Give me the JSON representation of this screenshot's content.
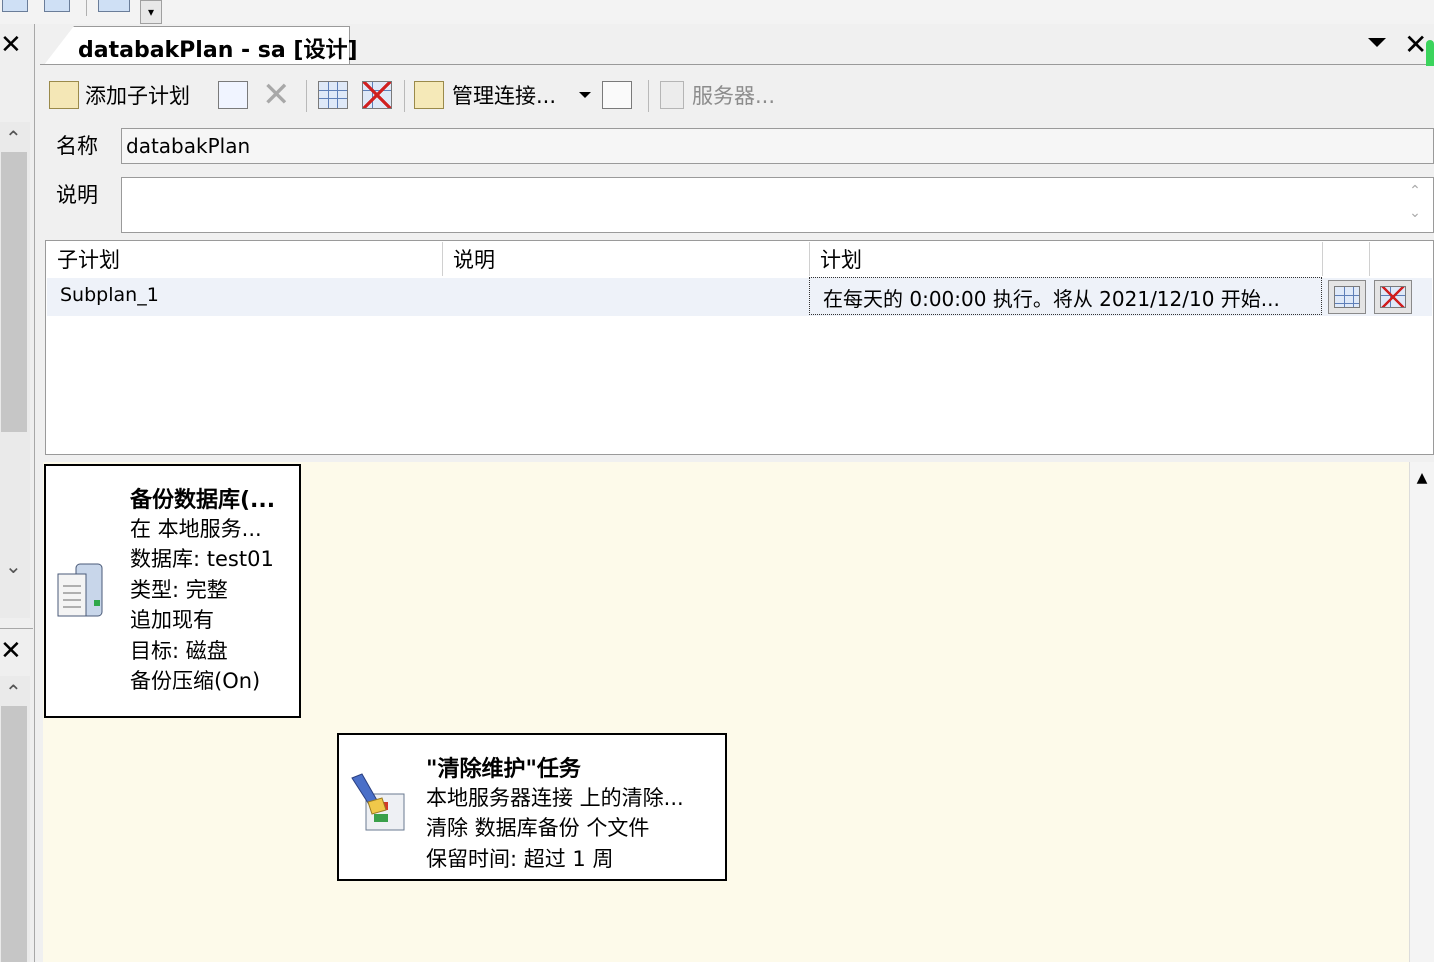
{
  "document_tab": {
    "title": "databakPlan - sa [设计]"
  },
  "toolbar": {
    "add_subplan": "添加子计划",
    "manage_connections": "管理连接...",
    "servers": "服务器..."
  },
  "form": {
    "name_label": "名称",
    "name_value": "databakPlan",
    "description_label": "说明",
    "description_value": ""
  },
  "subplans": {
    "columns": [
      "子计划",
      "说明",
      "计划"
    ],
    "rows": [
      {
        "name": "Subplan_1",
        "description": "",
        "schedule": "在每天的 0:00:00 执行。将从 2021/12/10 开始..."
      }
    ]
  },
  "tasks": [
    {
      "title": "备份数据库(...",
      "lines": [
        "在 本地服务...",
        "数据库: test01",
        "类型: 完整",
        "追加现有",
        "目标: 磁盘",
        "备份压缩(On)"
      ]
    },
    {
      "title": "\"清除维护\"任务",
      "lines": [
        "本地服务器连接 上的清除...",
        "清除 数据库备份 个文件",
        "保留时间: 超过 1 周"
      ]
    }
  ]
}
